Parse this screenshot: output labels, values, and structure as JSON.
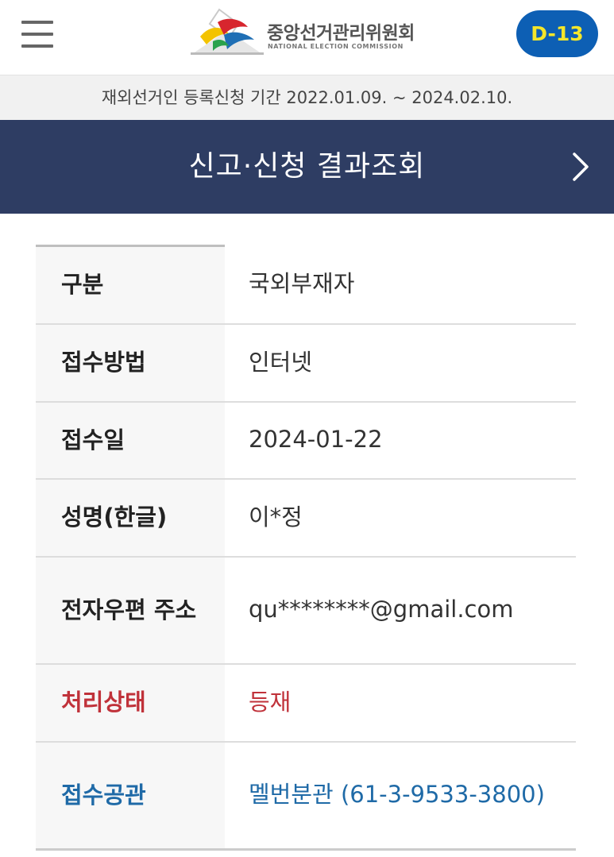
{
  "header": {
    "menu_icon": "hamburger-menu-icon",
    "logo_ko": "중앙선거관리위원회",
    "logo_en": "NATIONAL ELECTION COMMISSION",
    "dday_badge": "D-13",
    "colors": {
      "dday_bg": "#0d5fb4",
      "dday_text": "#f4e62a"
    }
  },
  "period_notice": "재외선거인 등록신청 기간 2022.01.09. ~ 2024.02.10.",
  "title_bar": {
    "title": "신고·신청 결과조회",
    "chevron_icon": "chevron-right-icon",
    "background": "#2e3d63"
  },
  "result_table": {
    "rows": [
      {
        "label": "구분",
        "value": "국외부재자"
      },
      {
        "label": "접수방법",
        "value": "인터넷"
      },
      {
        "label": "접수일",
        "value": "2024-01-22"
      },
      {
        "label": "성명(한글)",
        "value": "이*정"
      },
      {
        "label": "전자우편 주소",
        "value": "qu********@gmail.com"
      },
      {
        "label": "처리상태",
        "value": "등재",
        "color": "#c0323a"
      },
      {
        "label": "접수공관",
        "value": "멜번분관 (61-3-9533-3800)",
        "color": "#1f6aa7"
      }
    ]
  }
}
